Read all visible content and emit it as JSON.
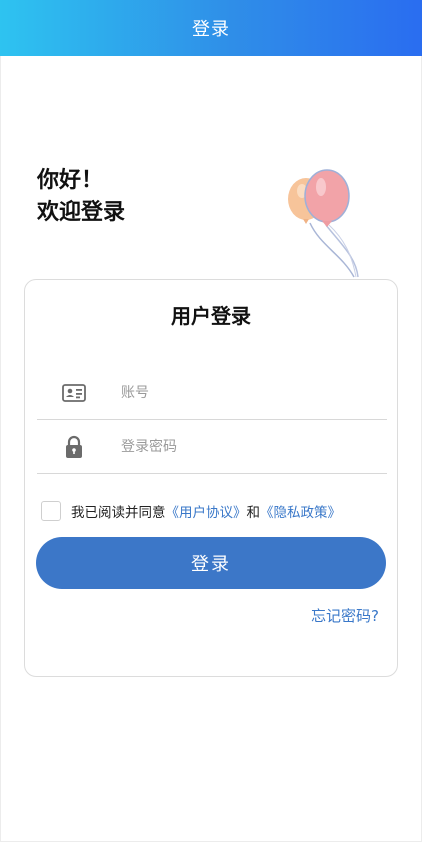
{
  "header": {
    "title": "登录"
  },
  "greeting": {
    "line1": "你好！",
    "line2": "欢迎登录"
  },
  "card": {
    "title": "用户登录",
    "account": {
      "placeholder": "账号",
      "value": ""
    },
    "password": {
      "placeholder": "登录密码",
      "value": ""
    },
    "agreement": {
      "checked": false,
      "prefix": "我已阅读并同意",
      "user_agreement": "《用户协议》",
      "and": "和",
      "privacy_policy": "《隐私政策》"
    },
    "login_button": "登录",
    "forgot_password": "忘记密码?"
  },
  "colors": {
    "header_gradient_start": "#2ec3f0",
    "header_gradient_end": "#2a6df0",
    "primary": "#3c77c8",
    "link": "#3a78c9"
  },
  "icons": {
    "account": "id-card-icon",
    "password": "lock-icon",
    "decoration": "balloons-icon"
  }
}
